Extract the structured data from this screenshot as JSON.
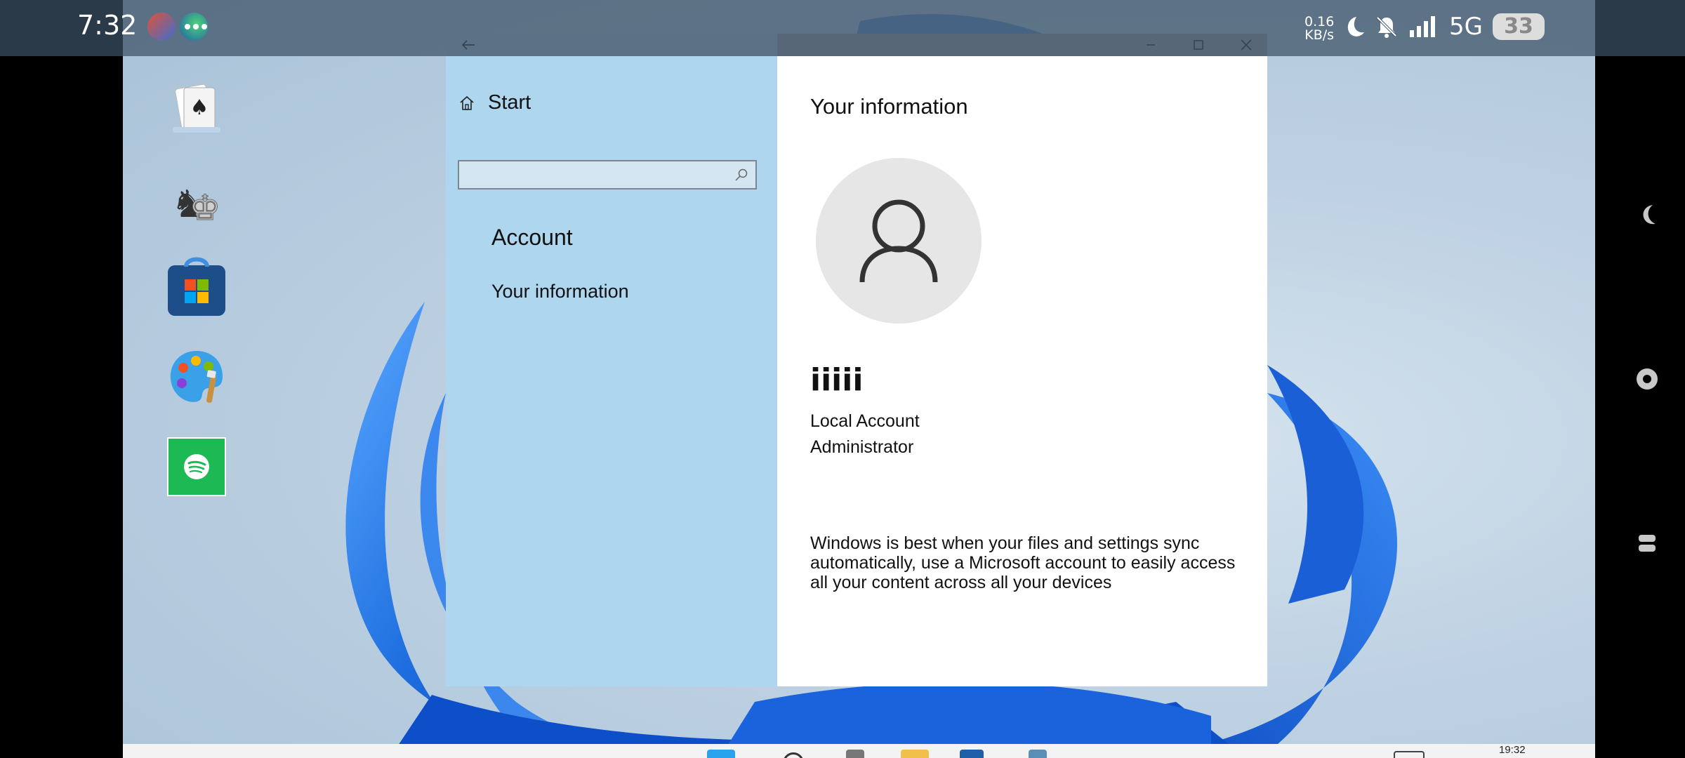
{
  "status_bar": {
    "time": "7:32",
    "net_speed_value": "0.16",
    "net_speed_unit": "KB/s",
    "network": "5G",
    "battery": "33",
    "icons": [
      "moon-icon",
      "bell-muted-icon",
      "signal-icon"
    ]
  },
  "desktop": {
    "icons": [
      "solitaire-icon",
      "chess-icon",
      "microsoft-store-icon",
      "paint-icon",
      "spotify-icon"
    ]
  },
  "window": {
    "back_label": "←",
    "controls": [
      "minimize",
      "maximize",
      "close"
    ]
  },
  "nav": {
    "start_label": "Start",
    "search_placeholder": "",
    "section_title": "Account",
    "items": [
      {
        "label": "Your information"
      }
    ]
  },
  "content": {
    "title": "Your information",
    "user_name": "iiiii",
    "account_type": "Local Account",
    "account_role": "Administrator",
    "sync_message": "Windows is best when your files and settings sync automatically, use a Microsoft account to easily access all your content across all your devices"
  },
  "taskbar": {
    "clock": "19:32"
  },
  "colors": {
    "nav_bg": "#aed6ee",
    "titlebar_right": "#9ea3a8",
    "bloom_blue": "#1f6fe0"
  }
}
